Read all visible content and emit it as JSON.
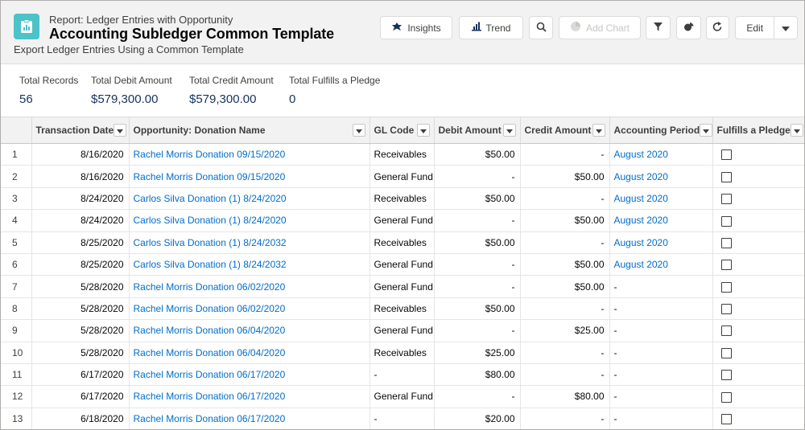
{
  "header": {
    "object_type": "Report: Ledger Entries with Opportunity",
    "title": "Accounting Subledger Common Template",
    "subtitle": "Export Ledger Entries Using a Common Template",
    "icon": "report-icon",
    "icon_color": "#4bc3c8"
  },
  "toolbar": {
    "insights_label": "Insights",
    "trend_label": "Trend",
    "add_chart_label": "Add Chart",
    "edit_label": "Edit"
  },
  "summary": {
    "metrics": [
      {
        "label": "Total Records",
        "value": "56"
      },
      {
        "label": "Total Debit Amount",
        "value": "$579,300.00"
      },
      {
        "label": "Total Credit Amount",
        "value": "$579,300.00"
      },
      {
        "label": "Total Fulfills a Pledge",
        "value": "0"
      }
    ]
  },
  "table": {
    "columns": [
      "",
      "Transaction Date",
      "Opportunity: Donation Name",
      "GL Code",
      "Debit Amount",
      "Credit Amount",
      "Accounting Period",
      "Fulfills a Pledge"
    ],
    "rows": [
      {
        "n": "1",
        "date": "8/16/2020",
        "name": "Rachel Morris Donation 09/15/2020",
        "gl": "Receivables",
        "debit": "$50.00",
        "credit": "-",
        "period": "August 2020",
        "pledge": false
      },
      {
        "n": "2",
        "date": "8/16/2020",
        "name": "Rachel Morris Donation 09/15/2020",
        "gl": "General Fund",
        "debit": "-",
        "credit": "$50.00",
        "period": "August 2020",
        "pledge": false
      },
      {
        "n": "3",
        "date": "8/24/2020",
        "name": "Carlos Silva Donation (1) 8/24/2020",
        "gl": "Receivables",
        "debit": "$50.00",
        "credit": "-",
        "period": "August 2020",
        "pledge": false
      },
      {
        "n": "4",
        "date": "8/24/2020",
        "name": "Carlos Silva Donation (1) 8/24/2020",
        "gl": "General Fund",
        "debit": "-",
        "credit": "$50.00",
        "period": "August 2020",
        "pledge": false
      },
      {
        "n": "5",
        "date": "8/25/2020",
        "name": "Carlos Silva Donation (1) 8/24/2032",
        "gl": "Receivables",
        "debit": "$50.00",
        "credit": "-",
        "period": "August 2020",
        "pledge": false
      },
      {
        "n": "6",
        "date": "8/25/2020",
        "name": "Carlos Silva Donation (1) 8/24/2032",
        "gl": "General Fund",
        "debit": "-",
        "credit": "$50.00",
        "period": "August 2020",
        "pledge": false
      },
      {
        "n": "7",
        "date": "5/28/2020",
        "name": "Rachel Morris Donation 06/02/2020",
        "gl": "General Fund",
        "debit": "-",
        "credit": "$50.00",
        "period": "-",
        "pledge": false
      },
      {
        "n": "8",
        "date": "5/28/2020",
        "name": "Rachel Morris Donation 06/02/2020",
        "gl": "Receivables",
        "debit": "$50.00",
        "credit": "-",
        "period": "-",
        "pledge": false
      },
      {
        "n": "9",
        "date": "5/28/2020",
        "name": "Rachel Morris Donation 06/04/2020",
        "gl": "General Fund",
        "debit": "-",
        "credit": "$25.00",
        "period": "-",
        "pledge": false
      },
      {
        "n": "10",
        "date": "5/28/2020",
        "name": "Rachel Morris Donation 06/04/2020",
        "gl": "Receivables",
        "debit": "$25.00",
        "credit": "-",
        "period": "-",
        "pledge": false
      },
      {
        "n": "11",
        "date": "6/17/2020",
        "name": "Rachel Morris Donation 06/17/2020",
        "gl": "-",
        "debit": "$80.00",
        "credit": "-",
        "period": "-",
        "pledge": false
      },
      {
        "n": "12",
        "date": "6/17/2020",
        "name": "Rachel Morris Donation 06/17/2020",
        "gl": "General Fund",
        "debit": "-",
        "credit": "$80.00",
        "period": "-",
        "pledge": false
      },
      {
        "n": "13",
        "date": "6/18/2020",
        "name": "Rachel Morris Donation 06/17/2020",
        "gl": "-",
        "debit": "$20.00",
        "credit": "-",
        "period": "-",
        "pledge": false
      }
    ]
  },
  "colors": {
    "link": "#006dcc",
    "metric_value": "#16325c",
    "header_bg": "#f3f2f2"
  }
}
